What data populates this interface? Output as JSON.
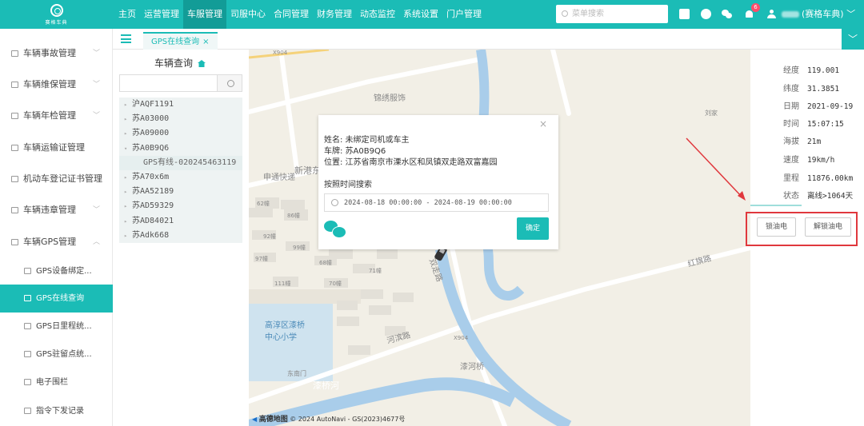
{
  "logo": {
    "text": "赛格车典"
  },
  "nav": [
    "主页",
    "运营管理",
    "车服管理",
    "司服中心",
    "合同管理",
    "财务管理",
    "动态监控",
    "系统设置",
    "门户管理"
  ],
  "nav_active": 2,
  "search": {
    "placeholder": "菜单搜索"
  },
  "notifications": {
    "count": "6"
  },
  "user": {
    "name": "(赛格车典)"
  },
  "sidebar": {
    "items": [
      {
        "label": "车辆事故管理",
        "chevron": "﹀"
      },
      {
        "label": "车辆维保管理",
        "chevron": "﹀"
      },
      {
        "label": "车辆年检管理",
        "chevron": "﹀"
      },
      {
        "label": "车辆运输证管理",
        "chevron": ""
      },
      {
        "label": "机动车登记证书管理",
        "chevron": ""
      },
      {
        "label": "车辆违章管理",
        "chevron": "﹀"
      },
      {
        "label": "车辆GPS管理",
        "chevron": "︿"
      }
    ],
    "sub_items": [
      {
        "label": "GPS设备绑定..."
      },
      {
        "label": "GPS在线查询"
      },
      {
        "label": "GPS日里程统..."
      },
      {
        "label": "GPS驻留点统..."
      },
      {
        "label": "电子围栏"
      },
      {
        "label": "指令下发记录"
      }
    ]
  },
  "tabs": {
    "active_label": "GPS在线查询",
    "close": "×",
    "dropdown": "﹀"
  },
  "tree": {
    "title": "车辆查询",
    "search_value": "",
    "search_placeholder": "",
    "nodes": [
      {
        "arrow": "▸",
        "label": "沪AQF1191"
      },
      {
        "arrow": "▸",
        "label": "苏A03000"
      },
      {
        "arrow": "▸",
        "label": "苏A09000"
      },
      {
        "arrow": "▾",
        "label": "苏A0B9Q6"
      },
      {
        "arrow": "",
        "label": "GPS有线-020245463119"
      },
      {
        "arrow": "▸",
        "label": "苏A70x6m"
      },
      {
        "arrow": "▸",
        "label": "苏AA52189"
      },
      {
        "arrow": "▸",
        "label": "苏AD59329"
      },
      {
        "arrow": "▸",
        "label": "苏AD84021"
      },
      {
        "arrow": "▸",
        "label": "苏Adk668"
      }
    ]
  },
  "map": {
    "labels": {
      "x904_top": "X904",
      "brocade": "锦绣服饰",
      "xingang": "新港东",
      "shenyou": "申通快递",
      "liujia": "刘家",
      "hongqi": "红旗路",
      "school": "高淳区漆桥中心小学",
      "henbin": "河滨路",
      "x904_mid": "X904",
      "qihe": "漆河桥",
      "east_gate": "东南门",
      "qiqiao": "漆桥河",
      "shuangzou": "双走路",
      "b62": "62幢",
      "b86": "86幢",
      "b92": "92幢",
      "b99": "99幢",
      "b97": "97幢",
      "b68": "68幢",
      "b71": "71幢",
      "b111": "111幢",
      "b70": "70幢"
    },
    "attribution_brand": "高德地图",
    "attribution": "© 2024 AutoNavi - GS(2023)4677号"
  },
  "popup": {
    "name_line": "姓名: 未绑定司机或车主",
    "plate_line": "车牌: 苏A0B9Q6",
    "location_line": "位置: 江苏省南京市溧水区和凤镇双走路双富嘉园",
    "search_title": "按照时间搜索",
    "date_range": "2024-08-18 00:00:00  -  2024-08-19 00:00:00",
    "confirm": "确定",
    "close": "×"
  },
  "info": {
    "rows": [
      {
        "label": "经度",
        "value": "119.001"
      },
      {
        "label": "纬度",
        "value": "31.3851"
      },
      {
        "label": "日期",
        "value": "2021-09-19"
      },
      {
        "label": "时间",
        "value": "15:07:15"
      },
      {
        "label": "海拔",
        "value": "21m"
      },
      {
        "label": "速度",
        "value": "19km/h"
      },
      {
        "label": "里程",
        "value": "11876.00km"
      },
      {
        "label": "状态",
        "value": "离线>1064天"
      }
    ],
    "lock_oil": "锁油电",
    "unlock_oil": "解锁油电"
  },
  "colors": {
    "accent": "#1bbcb6",
    "highlight": "#e0383d"
  }
}
